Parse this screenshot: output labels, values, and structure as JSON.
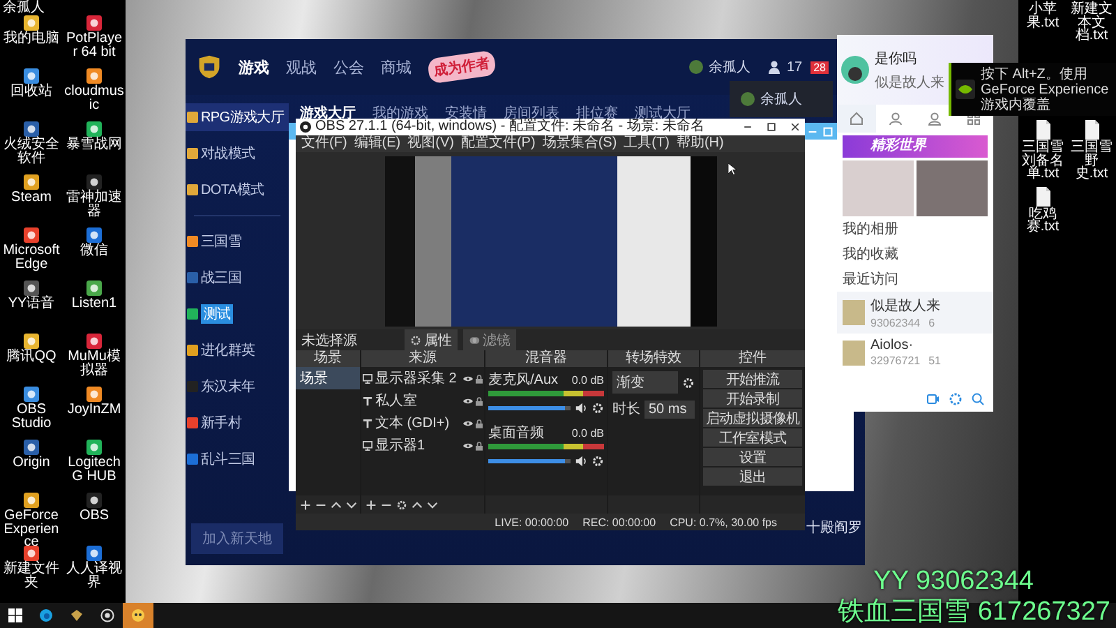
{
  "desktop": {
    "corner_text": "余孤人",
    "left_icons": [
      "我的电脑",
      "PotPlayer 64 bit",
      "回收站",
      "cloudmusic",
      "火绒安全软件",
      "暴雪战网",
      "Steam",
      "雷神加速器",
      "Microsoft Edge",
      "微信",
      "YY语音",
      "Listen1",
      "腾讯QQ",
      "MuMu模拟器",
      "OBS Studio",
      "JoyInZM",
      "Origin",
      "Logitech G HUB",
      "GeForce Experience",
      "OBS",
      "新建文件夹",
      "人人译视界"
    ],
    "right_icons_top": [
      "小苹果.txt",
      "新建文本文档.txt"
    ],
    "right_icons": [
      "三国雪刘备名单.txt",
      "三国雪野史.txt",
      "吃鸡赛.txt"
    ]
  },
  "game_window": {
    "nav": [
      {
        "label": "游戏",
        "selected": true
      },
      {
        "label": "观战",
        "selected": false
      },
      {
        "label": "公会",
        "selected": false
      },
      {
        "label": "商城",
        "selected": false
      }
    ],
    "promo": "成为作者",
    "user": "余孤人",
    "friends_count": "17",
    "alert_count": "28",
    "subtabs": [
      {
        "label": "游戏大厅",
        "selected": true
      },
      {
        "label": "我的游戏",
        "selected": false
      },
      {
        "label": "安装情",
        "selected": false
      },
      {
        "label": "房间列表",
        "selected": false
      },
      {
        "label": "排位赛",
        "selected": false
      },
      {
        "label": "测试大厅",
        "selected": false
      }
    ],
    "sidebar_modes": [
      {
        "label": "RPG游戏大厅",
        "selected": true
      },
      {
        "label": "对战模式",
        "selected": false
      },
      {
        "label": "DOTA模式",
        "selected": false
      }
    ],
    "sidebar_games": [
      {
        "kind": "game",
        "label": "三国雪",
        "selected": false
      },
      {
        "kind": "game",
        "label": "战三国",
        "selected": false
      },
      {
        "kind": "tag",
        "label": "测试",
        "selected": false
      },
      {
        "kind": "game",
        "label": "进化群英",
        "selected": false
      },
      {
        "kind": "game",
        "label": "东汉末年",
        "selected": false
      },
      {
        "kind": "game",
        "label": "新手村",
        "selected": false
      },
      {
        "kind": "game",
        "label": "乱斗三国",
        "selected": false
      }
    ],
    "join_button": "加入新天地",
    "account_menu": {
      "name": "余孤人"
    },
    "side_list": [
      "十殿阎罗"
    ]
  },
  "obs": {
    "title": "OBS 27.1.1 (64-bit, windows) - 配置文件: 未命名 - 场景: 未命名",
    "menu": [
      "文件(F)",
      "编辑(E)",
      "视图(V)",
      "配置文件(P)",
      "场景集合(S)",
      "工具(T)",
      "帮助(H)"
    ],
    "no_source": "未选择源",
    "properties_button": "属性",
    "filters_button": "滤镜",
    "docks": [
      "场景",
      "来源",
      "混音器",
      "转场特效",
      "控件"
    ],
    "scenes": [
      {
        "label": "场景",
        "selected": true
      }
    ],
    "sources": [
      {
        "kind": "monitor",
        "label": "显示器采集 2"
      },
      {
        "kind": "text",
        "label": "私人室"
      },
      {
        "kind": "text",
        "label": "文本 (GDI+)"
      },
      {
        "kind": "monitor",
        "label": "显示器1"
      }
    ],
    "mixer": [
      {
        "name": "麦克风/Aux",
        "reading": "0.0 dB",
        "level": 0.93
      },
      {
        "name": "桌面音频",
        "reading": "0.0 dB",
        "level": 0.93
      }
    ],
    "transition": {
      "type": "渐变",
      "duration_label": "时长",
      "duration": "50 ms"
    },
    "controls": [
      "开始推流",
      "开始录制",
      "启动虚拟摄像机",
      "工作室模式",
      "设置",
      "退出"
    ],
    "status": {
      "live": "LIVE: 00:00:00",
      "rec": "REC: 00:00:00",
      "cpu": "CPU: 0.7%, 30.00 fps"
    }
  },
  "qq_panel": {
    "name": "是你吗",
    "signature": "似是故人来",
    "tabs": [
      {
        "kind": "home",
        "selected": true
      },
      {
        "kind": "person",
        "selected": false
      },
      {
        "kind": "group",
        "selected": false
      },
      {
        "kind": "apps",
        "selected": false
      }
    ],
    "banner": "精彩世界",
    "links": [
      "我的相册",
      "我的收藏",
      "最近访问"
    ],
    "contacts": [
      {
        "name": "似是故人来",
        "id": "93062344",
        "count": "6"
      },
      {
        "name": "Aiolos·",
        "id": "32976721",
        "count": "51"
      }
    ]
  },
  "nvidia_toast": "按下 Alt+Z。使用 GeForce Experience 游戏内覆盖",
  "stream_overlay": [
    "YY 93062344",
    "铁血三国雪 617267327"
  ],
  "taskbar": [
    {
      "kind": "start",
      "active": false
    },
    {
      "kind": "browser",
      "active": false
    },
    {
      "kind": "app",
      "active": false
    },
    {
      "kind": "camera",
      "active": false
    },
    {
      "kind": "mascot",
      "active": true
    }
  ]
}
